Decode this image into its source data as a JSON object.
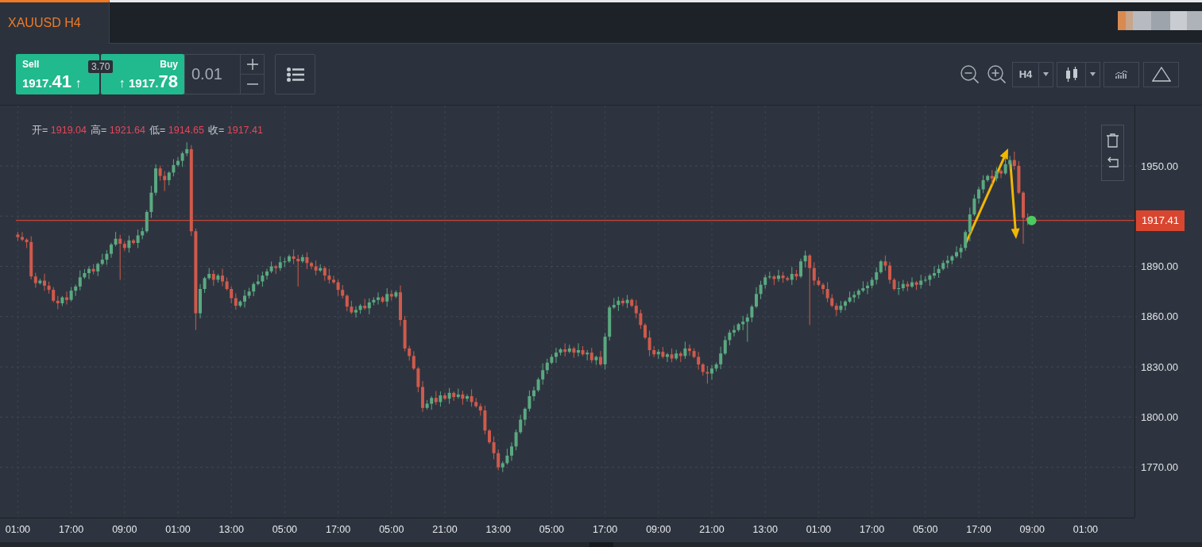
{
  "tab": {
    "label": "XAUUSD H4",
    "selected": true
  },
  "trade": {
    "sell": {
      "label": "Sell",
      "price_head": "1917.",
      "price_tail": "41",
      "arrow": "↑"
    },
    "spread": "3.70",
    "buy": {
      "label": "Buy",
      "arrow": "↑",
      "price_head": "1917.",
      "price_tail": "78"
    },
    "volume": "0.01"
  },
  "toolbar": {
    "timeframe": "H4"
  },
  "chart": {
    "legend": [
      {
        "label": "开=",
        "value": "1919.04"
      },
      {
        "label": "高=",
        "value": "1921.64"
      },
      {
        "label": "低=",
        "value": "1914.65"
      },
      {
        "label": "收=",
        "value": "1917.41"
      }
    ],
    "chart_data": {
      "type": "candlestick",
      "ylim": [
        1740,
        1986
      ],
      "grid": true,
      "ref_lines": [
        {
          "axis": "y",
          "value": 1917.41,
          "label": "1917.41"
        }
      ],
      "yticks": [
        {
          "value": 1950,
          "label": "1950.00"
        },
        {
          "value": 1890,
          "label": "1890.00"
        },
        {
          "value": 1860,
          "label": "1860.00"
        },
        {
          "value": 1830,
          "label": "1830.00"
        },
        {
          "value": 1800,
          "label": "1800.00"
        },
        {
          "value": 1770,
          "label": "1770.00"
        }
      ],
      "categories": [
        "01:00",
        null,
        null,
        null,
        null,
        null,
        null,
        null,
        null,
        null,
        null,
        null,
        "17:00",
        null,
        null,
        null,
        null,
        null,
        null,
        null,
        null,
        null,
        null,
        null,
        "09:00",
        null,
        null,
        null,
        null,
        null,
        null,
        null,
        null,
        null,
        null,
        null,
        "01:00",
        null,
        null,
        null,
        null,
        null,
        null,
        null,
        null,
        null,
        null,
        null,
        "13:00",
        null,
        null,
        null,
        null,
        null,
        null,
        null,
        null,
        null,
        null,
        null,
        "05:00",
        null,
        null,
        null,
        null,
        null,
        null,
        null,
        null,
        null,
        null,
        null,
        "17:00",
        null,
        null,
        null,
        null,
        null,
        null,
        null,
        null,
        null,
        null,
        null,
        "05:00",
        null,
        null,
        null,
        null,
        null,
        null,
        null,
        null,
        null,
        null,
        null,
        "21:00",
        null,
        null,
        null,
        null,
        null,
        null,
        null,
        null,
        null,
        null,
        null,
        "13:00",
        null,
        null,
        null,
        null,
        null,
        null,
        null,
        null,
        null,
        null,
        null,
        "05:00",
        null,
        null,
        null,
        null,
        null,
        null,
        null,
        null,
        null,
        null,
        null,
        "17:00",
        null,
        null,
        null,
        null,
        null,
        null,
        null,
        null,
        null,
        null,
        null,
        "09:00",
        null,
        null,
        null,
        null,
        null,
        null,
        null,
        null,
        null,
        null,
        null,
        "21:00",
        null,
        null,
        null,
        null,
        null,
        null,
        null,
        null,
        null,
        null,
        null,
        "13:00",
        null,
        null,
        null,
        null,
        null,
        null,
        null,
        null,
        null,
        null,
        null,
        "01:00",
        null,
        null,
        null,
        null,
        null,
        null,
        null,
        null,
        null,
        null,
        null,
        "17:00",
        null,
        null,
        null,
        null,
        null,
        null,
        null,
        null,
        null,
        null,
        null,
        "05:00",
        null,
        null,
        null,
        null,
        null,
        null,
        null,
        null,
        null,
        null,
        null,
        "17:00",
        null,
        null,
        null,
        null,
        null,
        null,
        null,
        null,
        null,
        null,
        null,
        "09:00",
        null,
        null,
        null,
        null,
        null,
        null,
        null,
        null,
        null,
        null,
        null,
        "01:00"
      ],
      "ohlc": [
        [
          1909,
          1910.6,
          1905.2,
          1907.5
        ],
        [
          1907.5,
          1910.4,
          1905,
          1906
        ],
        [
          1906,
          1906.8,
          1900.9,
          1904.5
        ],
        [
          1904.5,
          1908,
          1882.3,
          1884
        ],
        [
          1884,
          1886.2,
          1877.2,
          1880
        ],
        [
          1880,
          1882.6,
          1879.1,
          1881.5
        ],
        [
          1881.5,
          1885.6,
          1875.4,
          1878.5
        ],
        [
          1878.5,
          1880.9,
          1873.7,
          1876
        ],
        [
          1876,
          1877.6,
          1868.5,
          1869.5
        ],
        [
          1869.5,
          1872.4,
          1864.4,
          1868
        ],
        [
          1868,
          1872.3,
          1866.3,
          1871.5
        ],
        [
          1871.5,
          1875,
          1867.2,
          1870
        ],
        [
          1870,
          1877.7,
          1869.1,
          1875.5
        ],
        [
          1875.5,
          1879.1,
          1872.4,
          1878
        ],
        [
          1878,
          1887.6,
          1875.7,
          1883.5
        ],
        [
          1883.5,
          1888.4,
          1882.5,
          1886
        ],
        [
          1886,
          1890.1,
          1882.4,
          1888.5
        ],
        [
          1888.5,
          1891.4,
          1885.3,
          1887
        ],
        [
          1887,
          1892.3,
          1884.2,
          1891.5
        ],
        [
          1891.5,
          1897.5,
          1890.6,
          1894
        ],
        [
          1894,
          1899.7,
          1890.9,
          1897.5
        ],
        [
          1897.5,
          1904.1,
          1895.2,
          1903
        ],
        [
          1903,
          1910.6,
          1902,
          1906.5
        ],
        [
          1906.5,
          1908.9,
          1882,
          1903.5
        ],
        [
          1903.5,
          1905.1,
          1899.3,
          1901
        ],
        [
          1901,
          1908.4,
          1898.2,
          1905.5
        ],
        [
          1905.5,
          1906.3,
          1903.1,
          1904
        ],
        [
          1904,
          1912,
          1900.9,
          1908.5
        ],
        [
          1908.5,
          1913.2,
          1906.2,
          1911
        ],
        [
          1911,
          1923.6,
          1910,
          1922.5
        ],
        [
          1922.5,
          1938.1,
          1918.9,
          1934
        ],
        [
          1934,
          1950.9,
          1932.3,
          1948.5
        ],
        [
          1948.5,
          1950.1,
          1941.2,
          1944
        ],
        [
          1944,
          1946.9,
          1935,
          1941.5
        ],
        [
          1941.5,
          1946.8,
          1938.4,
          1946
        ],
        [
          1946,
          1954,
          1943.7,
          1950.5
        ],
        [
          1950.5,
          1955.2,
          1949.5,
          1953
        ],
        [
          1953,
          1958.6,
          1949.4,
          1957.5
        ],
        [
          1957.5,
          1964.1,
          1955.8,
          1960
        ],
        [
          1960,
          1962.4,
          1908.2,
          1911
        ],
        [
          1911,
          1912.6,
          1852,
          1862
        ],
        [
          1862,
          1879.4,
          1858.9,
          1876.5
        ],
        [
          1876.5,
          1883.8,
          1874.2,
          1883
        ],
        [
          1883,
          1889,
          1882,
          1885.5
        ],
        [
          1885.5,
          1887.7,
          1878.4,
          1882
        ],
        [
          1882,
          1885.6,
          1880.3,
          1884.5
        ],
        [
          1884.5,
          1888.6,
          1878.2,
          1881
        ],
        [
          1881,
          1883.4,
          1875.6,
          1876.5
        ],
        [
          1876.5,
          1878.1,
          1867.9,
          1871
        ],
        [
          1871,
          1873.9,
          1864.2,
          1866.5
        ],
        [
          1866.5,
          1869.8,
          1865.5,
          1869
        ],
        [
          1869,
          1876,
          1865.4,
          1872.5
        ],
        [
          1872.5,
          1877.2,
          1870.8,
          1875
        ],
        [
          1875,
          1880.6,
          1872.2,
          1879.5
        ],
        [
          1879.5,
          1885.1,
          1878.6,
          1881
        ],
        [
          1881,
          1886.9,
          1877.9,
          1884.5
        ],
        [
          1884.5,
          1888.6,
          1882.2,
          1887
        ],
        [
          1887,
          1892.9,
          1886,
          1890
        ],
        [
          1890,
          1890.8,
          1885.4,
          1889
        ],
        [
          1889,
          1896,
          1887.3,
          1892.5
        ],
        [
          1892.5,
          1895.2,
          1889.7,
          1893
        ],
        [
          1893,
          1897.1,
          1892.1,
          1896
        ],
        [
          1896,
          1900.1,
          1891.4,
          1894.5
        ],
        [
          1894.5,
          1896.9,
          1878,
          1893
        ],
        [
          1893,
          1897.1,
          1892,
          1895.5
        ],
        [
          1895.5,
          1898.4,
          1888.4,
          1892
        ],
        [
          1892,
          1892.8,
          1888.3,
          1890
        ],
        [
          1890,
          1893.5,
          1884.7,
          1887.5
        ],
        [
          1887.5,
          1891.2,
          1886.6,
          1889
        ],
        [
          1889,
          1890.1,
          1881.4,
          1884.5
        ],
        [
          1884.5,
          1888.6,
          1879.7,
          1882
        ],
        [
          1882,
          1884.4,
          1879.5,
          1880.5
        ],
        [
          1880.5,
          1882.1,
          1872.4,
          1876
        ],
        [
          1876,
          1878.9,
          1870.8,
          1872.5
        ],
        [
          1872.5,
          1873.3,
          1863.2,
          1866
        ],
        [
          1866,
          1869.5,
          1861.6,
          1862.5
        ],
        [
          1862.5,
          1866.2,
          1859.4,
          1864
        ],
        [
          1864,
          1867.6,
          1861.7,
          1866.5
        ],
        [
          1866.5,
          1870.6,
          1864,
          1865
        ],
        [
          1865,
          1870.9,
          1861.4,
          1868.5
        ],
        [
          1868.5,
          1871.6,
          1866.8,
          1870
        ],
        [
          1870,
          1874.4,
          1867.2,
          1871.5
        ],
        [
          1871.5,
          1872.3,
          1868.1,
          1869
        ],
        [
          1869,
          1877,
          1865.9,
          1873.5
        ],
        [
          1873.5,
          1875.7,
          1869.7,
          1872
        ],
        [
          1872,
          1875.6,
          1871,
          1874.5
        ],
        [
          1874.5,
          1878.6,
          1854.4,
          1858
        ],
        [
          1858,
          1860.4,
          1839.3,
          1841
        ],
        [
          1841,
          1842.6,
          1833.7,
          1836.5
        ],
        [
          1836.5,
          1839.4,
          1828.1,
          1829
        ],
        [
          1829,
          1829.8,
          1814.9,
          1818
        ],
        [
          1818,
          1821.5,
          1803.2,
          1805.5
        ],
        [
          1805.5,
          1810.2,
          1804.5,
          1808
        ],
        [
          1808,
          1812.6,
          1804.4,
          1811.5
        ],
        [
          1811.5,
          1815.6,
          1807.3,
          1809
        ],
        [
          1809,
          1815.4,
          1806.2,
          1813
        ],
        [
          1813,
          1814.6,
          1810.1,
          1811
        ],
        [
          1811,
          1817.4,
          1807.9,
          1814.5
        ],
        [
          1814.5,
          1815.3,
          1809.7,
          1812
        ],
        [
          1812,
          1817,
          1811,
          1813.5
        ],
        [
          1813.5,
          1815.7,
          1807.4,
          1811
        ],
        [
          1811,
          1813.6,
          1809.3,
          1812.5
        ],
        [
          1812.5,
          1816.6,
          1806.2,
          1809
        ],
        [
          1809,
          1811.4,
          1805.6,
          1806.5
        ],
        [
          1806.5,
          1808.1,
          1800.9,
          1804
        ],
        [
          1804,
          1806.9,
          1789.7,
          1792
        ],
        [
          1792,
          1792.8,
          1784,
          1785
        ],
        [
          1785,
          1788.5,
          1774.9,
          1778.5
        ],
        [
          1778.5,
          1780.7,
          1768.3,
          1770
        ],
        [
          1770,
          1773.6,
          1767.2,
          1772.5
        ],
        [
          1772.5,
          1781.1,
          1771.6,
          1777
        ],
        [
          1777,
          1784.9,
          1773.9,
          1782.5
        ],
        [
          1782.5,
          1792.6,
          1780.2,
          1791
        ],
        [
          1791,
          1801.4,
          1790,
          1798.5
        ],
        [
          1798.5,
          1805.8,
          1794.9,
          1805
        ],
        [
          1805,
          1816,
          1803.3,
          1812.5
        ],
        [
          1812.5,
          1818.2,
          1809.7,
          1816
        ],
        [
          1816,
          1823.6,
          1815.1,
          1822.5
        ],
        [
          1822.5,
          1832.1,
          1819.4,
          1828
        ],
        [
          1828,
          1834.9,
          1825.7,
          1832.5
        ],
        [
          1832.5,
          1837.6,
          1831.5,
          1836
        ],
        [
          1836,
          1841.4,
          1832.4,
          1838.5
        ],
        [
          1838.5,
          1841.3,
          1836.8,
          1840.5
        ],
        [
          1840.5,
          1844,
          1836.2,
          1839
        ],
        [
          1839,
          1843.2,
          1838.1,
          1841
        ],
        [
          1841,
          1842.1,
          1835.4,
          1838.5
        ],
        [
          1838.5,
          1844.1,
          1836.2,
          1840
        ],
        [
          1840,
          1842.4,
          1836.5,
          1837.5
        ],
        [
          1837.5,
          1840.1,
          1833.9,
          1838.5
        ],
        [
          1838.5,
          1841.4,
          1832.3,
          1834
        ],
        [
          1834,
          1836.8,
          1831.2,
          1836
        ],
        [
          1836,
          1839.5,
          1830.6,
          1831.5
        ],
        [
          1831.5,
          1850.2,
          1828.4,
          1848
        ],
        [
          1848,
          1866.6,
          1845.7,
          1865.5
        ],
        [
          1865.5,
          1871.1,
          1864.5,
          1867
        ],
        [
          1867,
          1871.9,
          1863.4,
          1869.5
        ],
        [
          1869.5,
          1871.1,
          1866.3,
          1868
        ],
        [
          1868,
          1872.9,
          1865.2,
          1870
        ],
        [
          1870,
          1870.8,
          1865.6,
          1866.5
        ],
        [
          1866.5,
          1870,
          1858.9,
          1862
        ],
        [
          1862,
          1864.2,
          1852.7,
          1855
        ],
        [
          1855,
          1856.1,
          1846.5,
          1847.5
        ],
        [
          1847.5,
          1851.6,
          1836.4,
          1840
        ],
        [
          1840,
          1842.4,
          1835.8,
          1837.5
        ],
        [
          1837.5,
          1840.6,
          1834.7,
          1839
        ],
        [
          1839,
          1841.9,
          1835.1,
          1836
        ],
        [
          1836,
          1838.3,
          1832.9,
          1837.5
        ],
        [
          1837.5,
          1841,
          1832.7,
          1835
        ],
        [
          1835,
          1840.2,
          1834,
          1838
        ],
        [
          1838,
          1839.1,
          1832.9,
          1836.5
        ],
        [
          1836.5,
          1845.1,
          1834.8,
          1841
        ],
        [
          1841,
          1843.4,
          1836.7,
          1839.5
        ],
        [
          1839.5,
          1841.1,
          1835.1,
          1836
        ],
        [
          1836,
          1838.9,
          1828.4,
          1831.5
        ],
        [
          1831.5,
          1832.3,
          1824.7,
          1827
        ],
        [
          1827,
          1830.5,
          1820,
          1826
        ],
        [
          1826,
          1831.2,
          1822.4,
          1829
        ],
        [
          1829,
          1832.6,
          1827.3,
          1831.5
        ],
        [
          1831.5,
          1842.1,
          1828.7,
          1838
        ],
        [
          1838,
          1848.4,
          1837.1,
          1846
        ],
        [
          1846,
          1852.1,
          1842.9,
          1850.5
        ],
        [
          1850.5,
          1854.9,
          1848.2,
          1852
        ],
        [
          1852,
          1856.3,
          1851,
          1855.5
        ],
        [
          1855.5,
          1860.5,
          1851.9,
          1857
        ],
        [
          1857,
          1861.7,
          1845,
          1859.5
        ],
        [
          1859.5,
          1867.1,
          1856.7,
          1866
        ],
        [
          1866,
          1877.6,
          1865.1,
          1873.5
        ],
        [
          1873.5,
          1881.4,
          1870.4,
          1879
        ],
        [
          1879,
          1885.1,
          1876.7,
          1883.5
        ],
        [
          1883.5,
          1886.9,
          1882.5,
          1884
        ],
        [
          1884,
          1884.8,
          1878.9,
          1882.5
        ],
        [
          1882.5,
          1888,
          1880.8,
          1884.5
        ],
        [
          1884.5,
          1886.7,
          1880.2,
          1883
        ],
        [
          1883,
          1884.1,
          1881.1,
          1882
        ],
        [
          1882,
          1889.6,
          1878.9,
          1885.5
        ],
        [
          1885.5,
          1887.9,
          1881.7,
          1884
        ],
        [
          1884,
          1894.6,
          1883,
          1893
        ],
        [
          1893,
          1899.4,
          1889.4,
          1896.5
        ],
        [
          1896.5,
          1897.3,
          1855,
          1889
        ],
        [
          1889,
          1892.5,
          1878.7,
          1881.5
        ],
        [
          1881.5,
          1883.7,
          1878.1,
          1879
        ],
        [
          1879,
          1880.1,
          1873.4,
          1876.5
        ],
        [
          1876.5,
          1880.6,
          1868.7,
          1871
        ],
        [
          1871,
          1873.4,
          1865.5,
          1866.5
        ],
        [
          1866.5,
          1868.1,
          1860.4,
          1864
        ],
        [
          1864,
          1869.4,
          1862.3,
          1866.5
        ],
        [
          1866.5,
          1869.8,
          1863.7,
          1869
        ],
        [
          1869,
          1875,
          1868.1,
          1871.5
        ],
        [
          1871.5,
          1875.2,
          1868.4,
          1873
        ],
        [
          1873,
          1876.6,
          1870.7,
          1875.5
        ],
        [
          1875.5,
          1881.1,
          1874.5,
          1877
        ],
        [
          1877,
          1880.9,
          1873.4,
          1878.5
        ],
        [
          1878.5,
          1883.6,
          1876.8,
          1882
        ],
        [
          1882,
          1889.4,
          1879.2,
          1886.5
        ],
        [
          1886.5,
          1893.8,
          1885.6,
          1893
        ],
        [
          1893,
          1896.5,
          1887.4,
          1890.5
        ],
        [
          1890.5,
          1892.7,
          1879.7,
          1882
        ],
        [
          1882,
          1883.1,
          1875.5,
          1876.5
        ],
        [
          1876.5,
          1881.1,
          1872.9,
          1877
        ],
        [
          1877,
          1881.9,
          1875.3,
          1879.5
        ],
        [
          1879.5,
          1881.1,
          1875.2,
          1878
        ],
        [
          1878,
          1883.4,
          1877.1,
          1880.5
        ],
        [
          1880.5,
          1881.3,
          1875.9,
          1879
        ],
        [
          1879,
          1885,
          1876.7,
          1881.5
        ],
        [
          1881.5,
          1884.2,
          1880.5,
          1882
        ],
        [
          1882,
          1885.6,
          1878.4,
          1884.5
        ],
        [
          1884.5,
          1890.1,
          1882.8,
          1886
        ],
        [
          1886,
          1890.9,
          1883.2,
          1888.5
        ],
        [
          1888.5,
          1893.6,
          1887.6,
          1892
        ],
        [
          1892,
          1896.4,
          1888.9,
          1893.5
        ],
        [
          1893.5,
          1896.8,
          1891.2,
          1896
        ],
        [
          1896,
          1902,
          1895,
          1898.5
        ],
        [
          1898.5,
          1903.2,
          1894.9,
          1901
        ],
        [
          1901,
          1911.6,
          1899.3,
          1910.5
        ],
        [
          1910.5,
          1925.1,
          1905,
          1921
        ],
        [
          1921,
          1932.9,
          1920.1,
          1930.5
        ],
        [
          1930.5,
          1937.6,
          1927.4,
          1936
        ],
        [
          1936,
          1944.4,
          1933.7,
          1941.5
        ],
        [
          1941.5,
          1944.8,
          1940.5,
          1944
        ],
        [
          1944,
          1947.5,
          1938.9,
          1942.5
        ],
        [
          1942.5,
          1949.2,
          1940.8,
          1947
        ],
        [
          1947,
          1948.1,
          1942.7,
          1945.5
        ],
        [
          1945.5,
          1955.1,
          1944.6,
          1951
        ],
        [
          1951,
          1955.9,
          1947.9,
          1953.5
        ],
        [
          1953.5,
          1958.5,
          1947.7,
          1950
        ],
        [
          1950,
          1952.9,
          1933,
          1934
        ],
        [
          1934,
          1934.8,
          1903.5,
          1919.04
        ],
        [
          1919.04,
          1921.64,
          1914.65,
          1917.41
        ],
        null,
        null,
        null,
        null,
        null,
        null,
        null,
        null,
        null,
        null,
        null,
        null,
        null
      ]
    }
  }
}
